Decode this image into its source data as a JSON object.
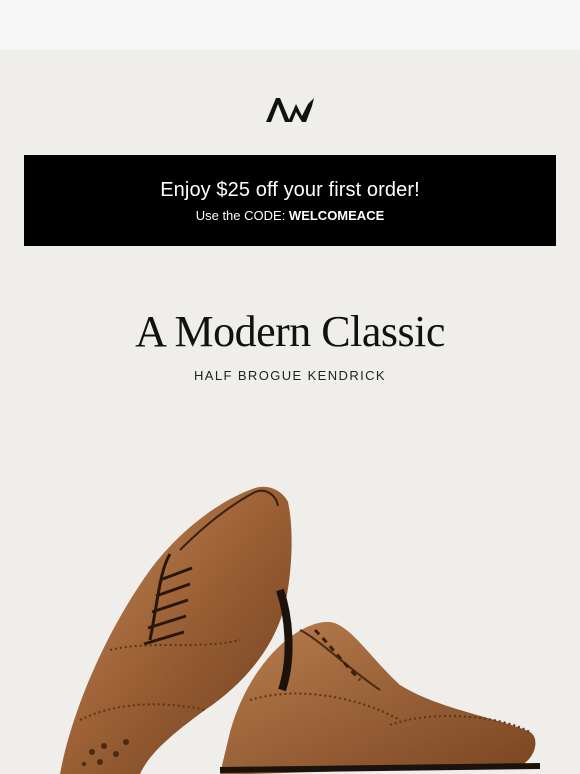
{
  "brand": {
    "logo_text": "AM"
  },
  "promo": {
    "headline": "Enjoy $25 off your first order!",
    "code_prefix": "Use the CODE: ",
    "code": "WELCOMEACE"
  },
  "hero": {
    "title": "A Modern Classic",
    "subtitle": "HALF BROGUE KENDRICK"
  },
  "product_image": {
    "icon": "brogue-shoe-image"
  },
  "colors": {
    "background": "#efeeeb",
    "promo_bg": "#000000",
    "leather": "#9a5f34"
  }
}
